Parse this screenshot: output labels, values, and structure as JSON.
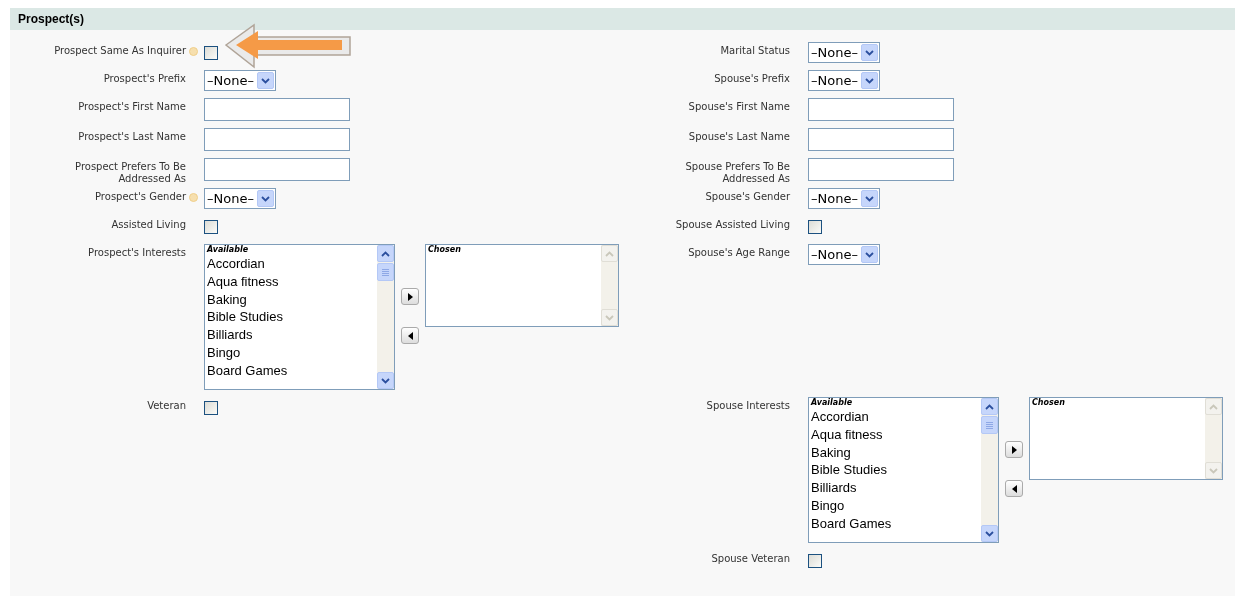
{
  "section": {
    "title": "Prospect(s)"
  },
  "rows": [
    {
      "left": {
        "label": "Prospect Same As Inquirer",
        "kind": "checkbox",
        "help": true,
        "checked": false
      },
      "right": {
        "label": "Marital Status",
        "kind": "select",
        "value": "–None–"
      }
    },
    {
      "left": {
        "label": "Prospect's Prefix",
        "kind": "select",
        "value": "–None–"
      },
      "right": {
        "label": "Spouse's Prefix",
        "kind": "select",
        "value": "–None–"
      }
    },
    {
      "left": {
        "label": "Prospect's First Name",
        "kind": "text"
      },
      "right": {
        "label": "Spouse's First Name",
        "kind": "text"
      }
    },
    {
      "left": {
        "label": "Prospect's Last Name",
        "kind": "text"
      },
      "right": {
        "label": "Spouse's Last Name",
        "kind": "text"
      }
    },
    {
      "left": {
        "label": "Prospect Prefers To Be Addressed As",
        "kind": "text"
      },
      "right": {
        "label": "Spouse Prefers To Be Addressed As",
        "kind": "text"
      }
    },
    {
      "left": {
        "label": "Prospect's Gender",
        "kind": "select",
        "help": true,
        "value": "–None–"
      },
      "right": {
        "label": "Spouse's Gender",
        "kind": "select",
        "value": "–None–"
      }
    },
    {
      "left": {
        "label": "Assisted Living",
        "kind": "checkbox",
        "checked": false
      },
      "right": {
        "label": "Spouse Assisted Living",
        "kind": "checkbox",
        "checked": false
      }
    },
    {
      "left": {
        "label": "Prospect's Interests",
        "kind": "multiselect",
        "available_heading": "Available",
        "options": [
          "Accordian",
          "Aqua fitness",
          "Baking",
          "Bible Studies",
          "Billiards",
          "Bingo",
          "Board Games"
        ],
        "chosen_heading": "Chosen"
      },
      "right": {
        "label": "Spouse's Age Range",
        "kind": "select",
        "value": "–None–"
      }
    },
    {
      "left": {
        "label": "Veteran",
        "kind": "checkbox",
        "checked": false
      },
      "right": {
        "label": "Spouse Interests",
        "kind": "multiselect",
        "available_heading": "Available",
        "options": [
          "Accordian",
          "Aqua fitness",
          "Baking",
          "Bible Studies",
          "Billiards",
          "Bingo",
          "Board Games"
        ],
        "chosen_heading": "Chosen"
      }
    },
    {
      "right": {
        "label": "Spouse Veteran",
        "kind": "checkbox",
        "checked": false
      }
    }
  ]
}
